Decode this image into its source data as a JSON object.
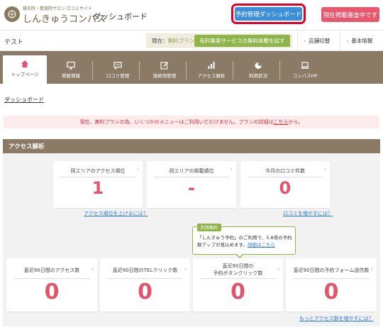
{
  "header": {
    "logo_sub": "鍼灸院・整骨院サロン 口コミサイト",
    "logo_main": "しんきゅうコンパス",
    "page_title": "ダッシュボード",
    "reserve_button": "予約管理ダッシュボード",
    "status_button": "現在掲載審査中です"
  },
  "subbar": {
    "shop_name": "テスト",
    "plan_prefix": "現在：",
    "plan_value": "無料プラン",
    "trial_button": "有料集客サービスの無料体験を試す",
    "switch_shop": "店舗切替",
    "basic_info": "基本情報"
  },
  "tabs": [
    {
      "label": "トップページ",
      "icon": "home-icon"
    },
    {
      "label": "掲載情報",
      "icon": "monitor-icon"
    },
    {
      "label": "口コミ管理",
      "icon": "chat-icon"
    },
    {
      "label": "施術例管理",
      "icon": "edit-icon"
    },
    {
      "label": "アクセス解析",
      "icon": "bar-chart-icon"
    },
    {
      "label": "利用状況",
      "icon": "pie-chart-icon"
    },
    {
      "label": "コンパスHP",
      "icon": "laptop-icon"
    }
  ],
  "breadcrumb": "ダッシュボード",
  "notice": {
    "text": "現在、無料プランの為、いくつかのメニューはご利用いただけません。プランの詳細は",
    "link": "こちら",
    "suffix": "から。"
  },
  "panel": {
    "title": "アクセス解析",
    "top_cards": [
      {
        "title": "同エリアのアクセス順位",
        "value": "1"
      },
      {
        "title": "同エリアの掲載順位",
        "value": "-"
      },
      {
        "title": "今月の口コミ件数",
        "value": "0"
      }
    ],
    "link_access_rank": "アクセス順位を上げるには？",
    "link_reviews": "口コミを増やすには？",
    "tip": {
      "badge": "利用無料",
      "text": "「しんきゅう予約」のご利用で、5.8倍の予約数アップが見込めます。",
      "link": "詳細はこちら"
    },
    "bottom_cards": [
      {
        "title": "直近90日間のアクセス数",
        "value": "0"
      },
      {
        "title": "直近90日間のTELクリック数",
        "value": "0"
      },
      {
        "title_line1": "直近90日間の",
        "title_line2": "予約ボタンクリック数",
        "value": "0"
      },
      {
        "title": "直近90日間の予約フォーム送信数",
        "value": "0"
      }
    ],
    "link_more_access": "もっとアクセス数を増やすには？"
  },
  "colors": {
    "brown": "#8b7a66",
    "accent_pink": "#e0546c",
    "blue_button": "#3a8fd9",
    "highlight_red": "#e0002a",
    "green": "#8fb54a"
  }
}
